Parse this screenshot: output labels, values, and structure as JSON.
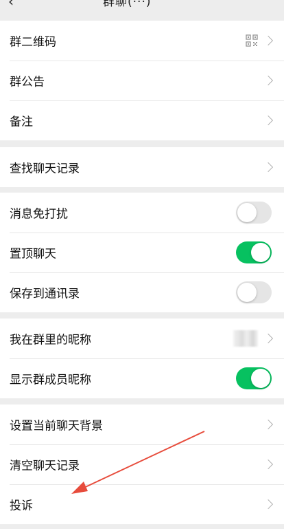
{
  "header": {
    "back_icon": "back-arrow-icon",
    "title": "群聊(···)",
    "more_icon": "more-icon"
  },
  "group1": [
    {
      "label": "群二维码",
      "accessory": "qr-code-icon"
    },
    {
      "label": "群公告"
    },
    {
      "label": "备注"
    }
  ],
  "group2": [
    {
      "label": "查找聊天记录"
    }
  ],
  "group3": [
    {
      "label": "消息免打扰",
      "toggle": false
    },
    {
      "label": "置顶聊天",
      "toggle": true
    },
    {
      "label": "保存到通讯录",
      "toggle": false
    }
  ],
  "group4": [
    {
      "label": "我在群里的昵称",
      "value": "(blurred)"
    },
    {
      "label": "显示群成员昵称",
      "toggle": true
    }
  ],
  "group5": [
    {
      "label": "设置当前聊天背景"
    },
    {
      "label": "清空聊天记录"
    },
    {
      "label": "投诉"
    }
  ],
  "colors": {
    "toggle_on": "#07c160",
    "toggle_off": "#e5e5e5",
    "annotation_arrow": "#e74c3c",
    "background": "#ededed"
  }
}
